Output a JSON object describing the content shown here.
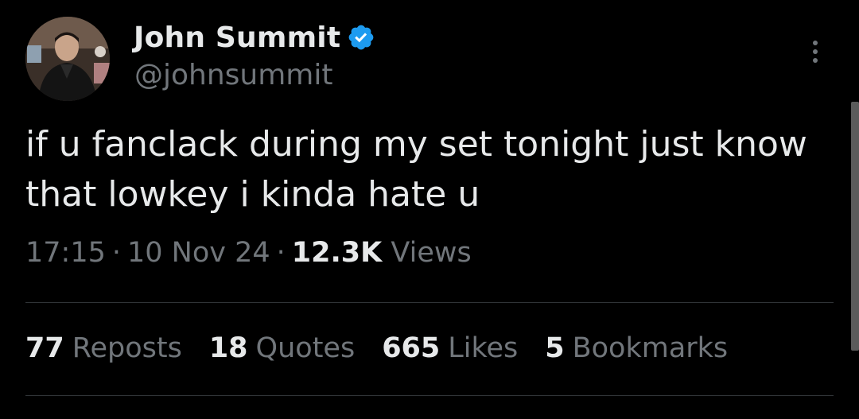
{
  "author": {
    "display_name": "John Summit",
    "handle": "@johnsummit",
    "avatar_icon": "profile-photo",
    "verified_icon": "verified-badge-icon"
  },
  "menu_icon": "more-vertical-icon",
  "tweet": {
    "text_line1": "if u fanclack during my set tonight just know",
    "text_line2": "that lowkey i kinda hate u"
  },
  "meta": {
    "time": "17:15",
    "date": "10 Nov 24",
    "views_count": "12.3K",
    "views_label": "Views",
    "separator": "·"
  },
  "stats": [
    {
      "count": "77",
      "label": "Reposts"
    },
    {
      "count": "18",
      "label": "Quotes"
    },
    {
      "count": "665",
      "label": "Likes"
    },
    {
      "count": "5",
      "label": "Bookmarks"
    }
  ],
  "colors": {
    "background": "#000000",
    "primary_text": "#e7e9ea",
    "secondary_text": "#71767b",
    "verified": "#1d9bf0",
    "divider": "#2f3336"
  }
}
